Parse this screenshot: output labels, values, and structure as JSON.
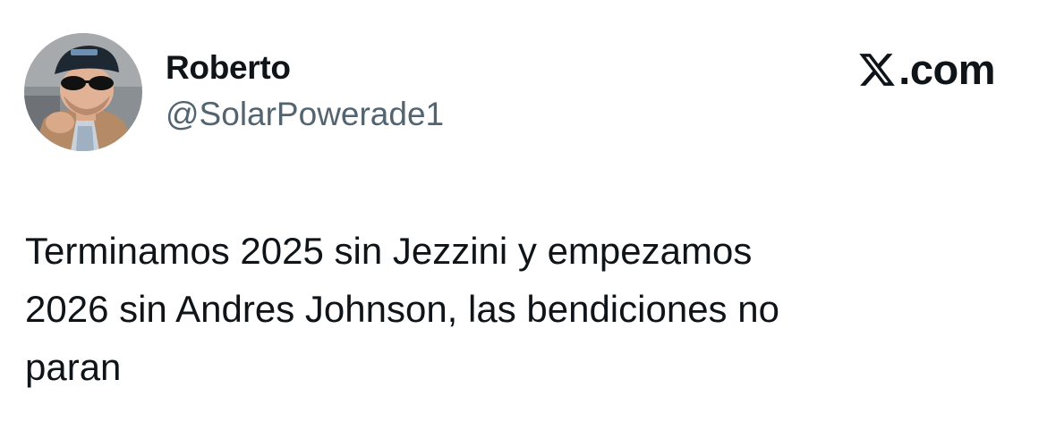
{
  "author": {
    "display_name": "Roberto",
    "handle": "@SolarPowerade1"
  },
  "brand": {
    "logo_icon": "x-logo-icon",
    "suffix": ".com"
  },
  "tweet": {
    "text": "Terminamos 2025 sin Jezzini y empezamos\n2026 sin Andres Johnson, las bendiciones no\nparan"
  },
  "colors": {
    "text_primary": "#0f1419",
    "text_secondary": "#536471",
    "background": "#ffffff"
  }
}
